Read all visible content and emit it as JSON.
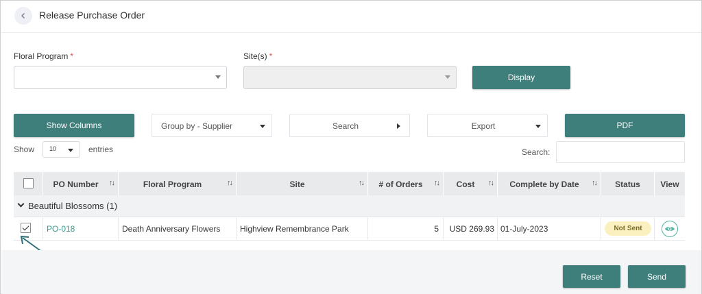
{
  "header": {
    "title": "Release Purchase Order",
    "back_icon": "chevron-left-icon"
  },
  "form": {
    "floral_program": {
      "label": "Floral Program",
      "required": "*",
      "value": ""
    },
    "sites": {
      "label": "Site(s)",
      "required": "*",
      "value": ""
    },
    "display_label": "Display"
  },
  "toolbar": {
    "show_columns": "Show Columns",
    "group_by": "Group by - Supplier",
    "search": "Search",
    "export": "Export",
    "pdf": "PDF"
  },
  "entries": {
    "show": "Show",
    "value": "10",
    "suffix": "entries"
  },
  "search": {
    "label": "Search:",
    "value": ""
  },
  "table": {
    "columns": [
      "PO Number",
      "Floral Program",
      "Site",
      "# of Orders",
      "Cost",
      "Complete by Date",
      "Status",
      "View"
    ],
    "sort_icon": "↑↓",
    "group": {
      "label": "Beautiful Blossoms (1)"
    },
    "rows": [
      {
        "checked": true,
        "po_number": "PO-018",
        "floral_program": "Death Anniversary Flowers",
        "site": "Highview Remembrance Park",
        "orders": "5",
        "cost": "USD 269.93",
        "complete_by": "01-July-2023",
        "status": "Not Sent"
      }
    ]
  },
  "footer": {
    "reset": "Reset",
    "send": "Send"
  },
  "colors": {
    "accent": "#3e7e7b",
    "link": "#3a9a8c",
    "badge_bg": "#fbf1c0",
    "required": "#d9534f"
  }
}
